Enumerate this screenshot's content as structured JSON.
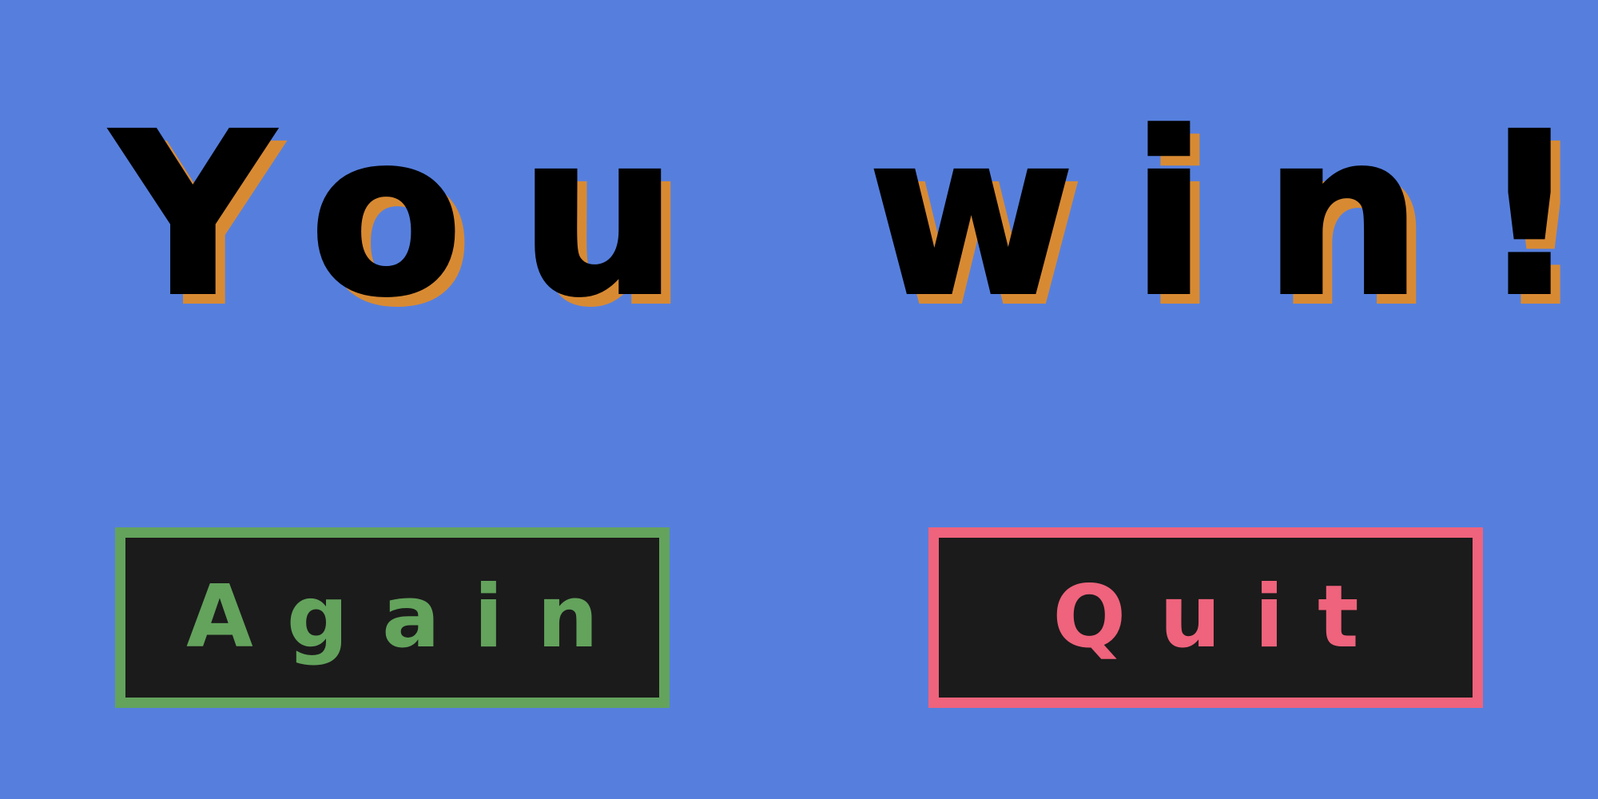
{
  "screen": {
    "title": "You win!"
  },
  "buttons": {
    "again_label": "Again",
    "quit_label": "Quit"
  },
  "colors": {
    "background": "#567fdd",
    "title_text": "#000000",
    "title_shadow": "#d88a33",
    "again_accent": "#63a35c",
    "quit_accent": "#ef637c",
    "button_fill": "#1b1b1b"
  }
}
